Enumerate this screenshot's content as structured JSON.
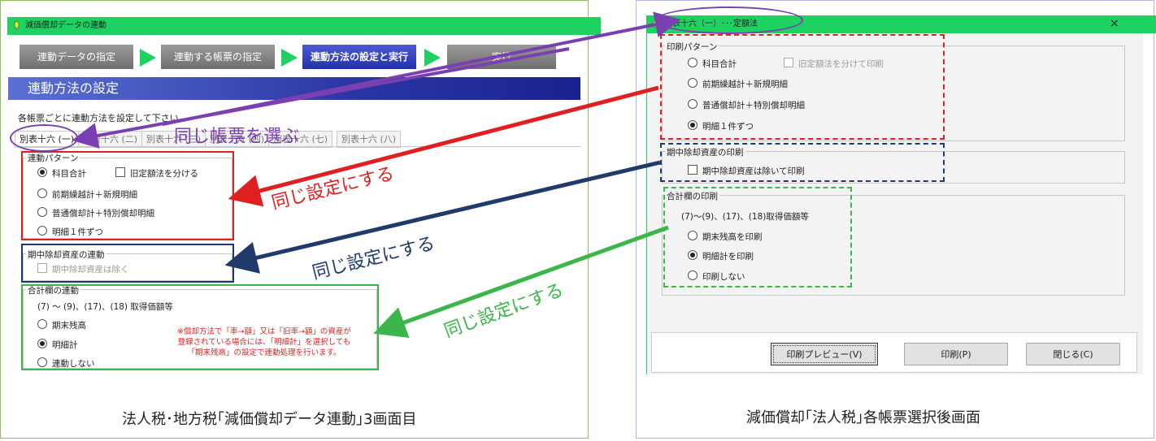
{
  "left": {
    "window_title": "減価償却データの連動",
    "wizard_steps": [
      "連動データの指定",
      "連動する帳票の指定",
      "連動方法の設定と実行",
      "実行"
    ],
    "section_title": "連動方法の設定",
    "instruction": "各帳票ごとに連動方法を設定して下さい。",
    "tabs": [
      "別表十六 (一)",
      "別表十六 (二)",
      "別表十六 (三)",
      "別表十六 (四)",
      "別表十六 (五)",
      "別表十六 (六)",
      "別表十六 (七)",
      "別表十六 (八)"
    ],
    "pattern_group": {
      "title": "連動パターン",
      "options": [
        "科目合計",
        "前期繰越計＋新規明細",
        "普通償却計＋特別償却明細",
        "明細１件ずつ"
      ],
      "checkbox": "旧定額法を分ける"
    },
    "mid_group": {
      "title": "期中除却資産の連動",
      "checkbox": "期中除却資産は除く"
    },
    "total_group": {
      "title": "合計欄の連動",
      "subtitle": "(7) ～ (9)、(17)、(18) 取得価額等",
      "options": [
        "期末残高",
        "明細計",
        "連動しない"
      ]
    },
    "note": [
      "※償却方法で「率→額」又は「旧率→額」の資産が",
      "登録されている場合には、「明細計」を選択しても",
      "「期末残高」の設定で連動処理を行います。"
    ],
    "caption": "法人税･地方税｢減価償却データ連動｣3画面目"
  },
  "right": {
    "window_title": "別表十六（一）･･･定額法",
    "close_glyph": "×",
    "pattern_group": {
      "title": "印刷パターン",
      "options": [
        "科目合計",
        "前期繰越計＋新規明細",
        "普通償却計＋特別償却明細",
        "明細１件ずつ"
      ],
      "checkbox": "旧定額法を分けて印刷"
    },
    "mid_group": {
      "title": "期中除却資産の印刷",
      "checkbox": "期中除却資産は除いて印刷"
    },
    "total_group": {
      "title": "合計欄の印刷",
      "subtitle": "(7)～(9)、(17)、(18)取得価額等",
      "options": [
        "期末残高を印刷",
        "明細計を印刷",
        "印刷しない"
      ]
    },
    "buttons": [
      "印刷プレビュー(V)",
      "印刷(P)",
      "閉じる(C)"
    ],
    "caption": "減価償却｢法人税｣各帳票選択後画面"
  },
  "annotations": {
    "same_form": "同じ帳票を選ぶ",
    "same_setting": "同じ設定にする"
  },
  "colors": {
    "purple": "#7a3fb0",
    "red": "#e02020",
    "navy": "#1f3a6b",
    "green": "#3cb54a"
  }
}
